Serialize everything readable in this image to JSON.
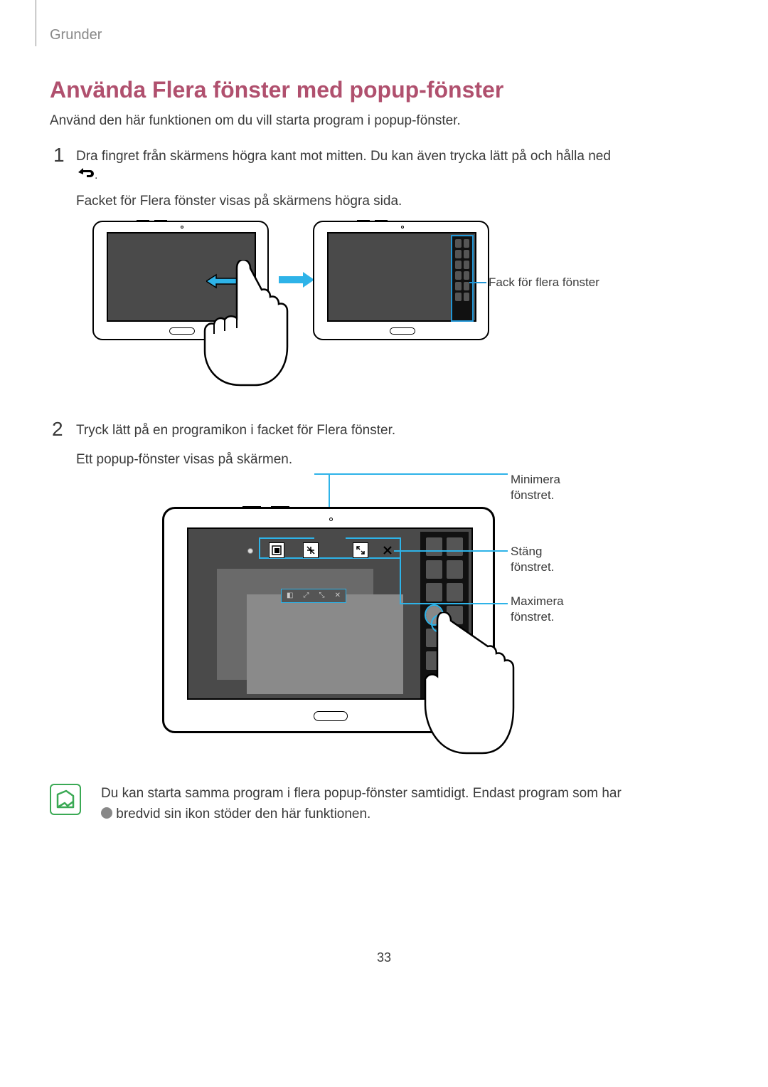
{
  "header": {
    "section": "Grunder"
  },
  "title": "Använda Flera fönster med popup-fönster",
  "intro": "Använd den här funktionen om du vill starta program i popup-fönster.",
  "step1": {
    "num": "1",
    "line1": "Dra fingret från skärmens högra kant mot mitten. Du kan även trycka lätt på och hålla ned",
    "line1_suffix": ".",
    "line2": "Facket för Flera fönster visas på skärmens högra sida."
  },
  "fig1": {
    "callout_tray": "Fack för flera fönster"
  },
  "step2": {
    "num": "2",
    "line1": "Tryck lätt på en programikon i facket för Flera fönster.",
    "line2": "Ett popup-fönster visas på skärmen."
  },
  "fig2": {
    "callout_minimize": "Minimera fönstret.",
    "callout_close": "Stäng fönstret.",
    "callout_maximize": "Maximera fönstret."
  },
  "tip": {
    "text_a": "Du kan starta samma program i flera popup-fönster samtidigt. Endast program som har",
    "text_b": "bredvid sin ikon stöder den här funktionen."
  },
  "page_number": "33"
}
